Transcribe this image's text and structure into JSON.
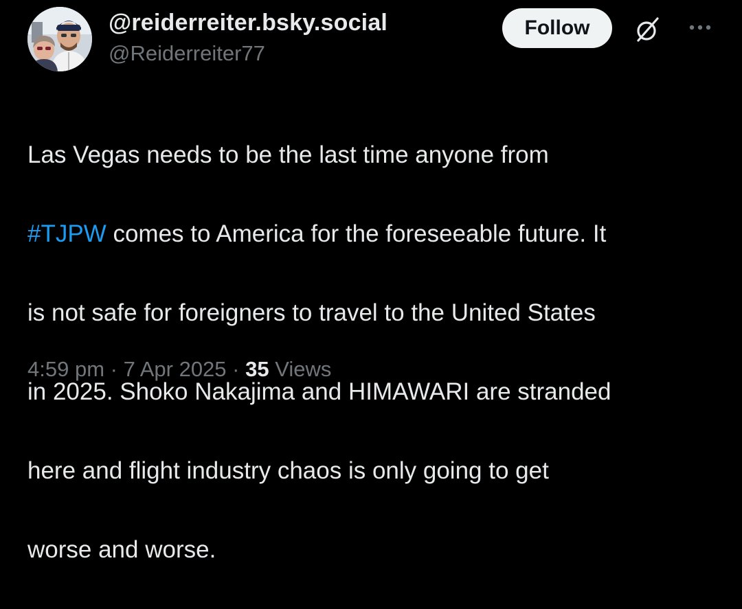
{
  "author": {
    "display_name": "@reiderreiter.bsky.social",
    "handle": "@Reiderreiter77",
    "avatar_icon": "profile-photo"
  },
  "actions": {
    "follow_label": "Follow",
    "grok_icon": "grok-slash-icon",
    "more_icon": "more-horizontal-icon"
  },
  "post": {
    "lines": [
      {
        "text": "Las Vegas needs to be the last time anyone from"
      },
      {
        "hashtag": "#TJPW",
        "text": " comes to America for the foreseeable future. It"
      },
      {
        "text": "is not safe for foreigners to travel to the United States"
      },
      {
        "text": "in 2025. Shoko Nakajima and HIMAWARI are stranded"
      },
      {
        "text": "here and flight industry chaos is only going to get"
      },
      {
        "text": "worse and worse."
      }
    ]
  },
  "meta": {
    "time": "4:59 pm",
    "separator": " · ",
    "date": "7 Apr 2025",
    "views_count": "35",
    "views_label": " Views"
  },
  "colors": {
    "background": "#000000",
    "text": "#e7e9ea",
    "secondary": "#71767b",
    "link": "#1d9bf0",
    "button_bg": "#eff3f4"
  }
}
